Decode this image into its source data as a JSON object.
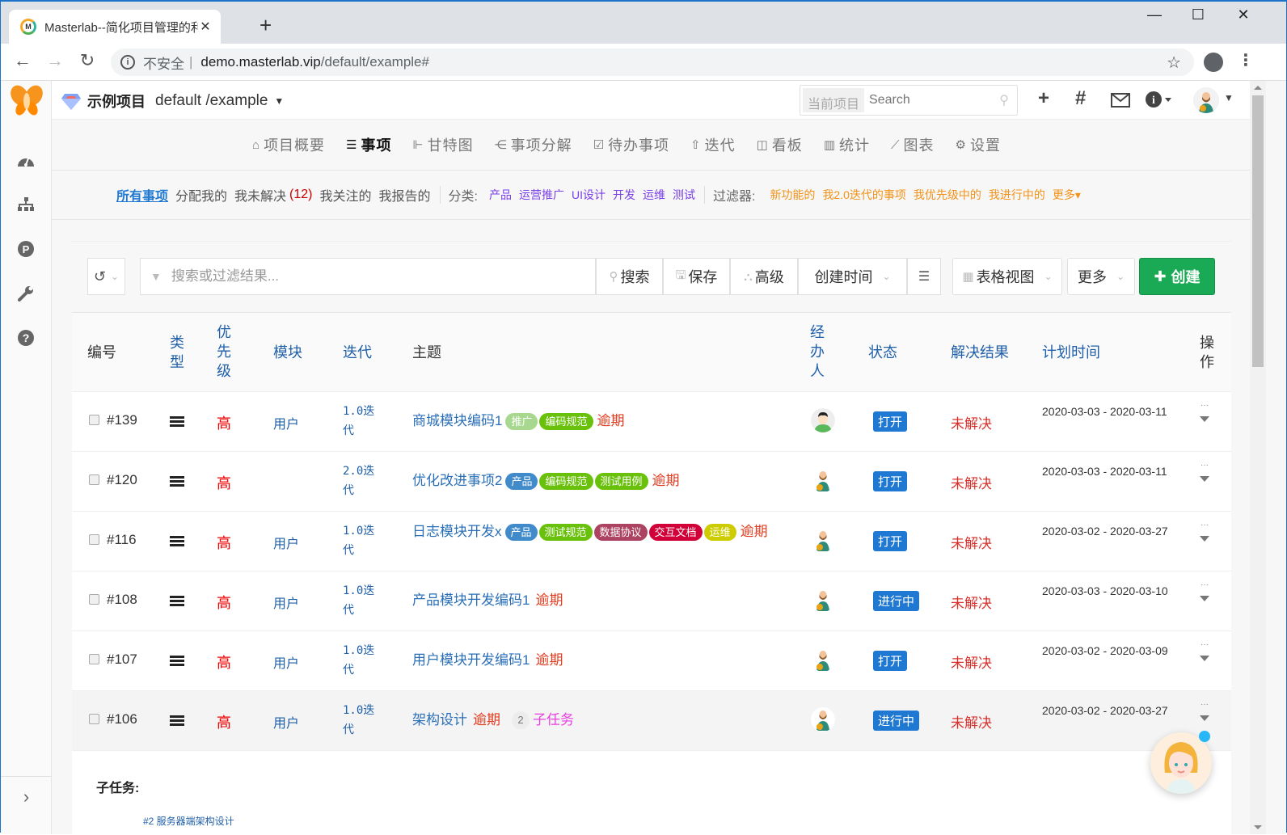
{
  "browser": {
    "tab_title": "Masterlab--简化项目管理的利器",
    "tab_favicon": "masterlab-logo-icon",
    "new_tab": "+",
    "url_insecure": "不安全",
    "url_sep": "|",
    "url_host": "demo.masterlab.vip",
    "url_path": "/default/example#",
    "controls": {
      "minimize": "—",
      "maximize": "☐",
      "close": "✕"
    }
  },
  "header": {
    "project_name": "示例项目",
    "project_path": "default /example",
    "search_scope": "当前项目",
    "search_placeholder": "Search",
    "icons": [
      "plus-icon",
      "hash-icon",
      "mail-icon",
      "info-icon",
      "user-avatar"
    ]
  },
  "sidebar": {
    "icons": [
      "dashboard-icon",
      "sitemap-icon",
      "project-p-icon",
      "wrench-icon",
      "help-icon"
    ],
    "expand": "›"
  },
  "subnav": [
    {
      "icon": "⌂",
      "label": "项目概要",
      "active": false
    },
    {
      "icon": "☰",
      "label": "事项",
      "active": true
    },
    {
      "icon": "⊩",
      "label": "甘特图",
      "active": false
    },
    {
      "icon": "⋲",
      "label": "事项分解",
      "active": false
    },
    {
      "icon": "☑",
      "label": "待办事项",
      "active": false
    },
    {
      "icon": "⇧",
      "label": "迭代",
      "active": false
    },
    {
      "icon": "◫",
      "label": "看板",
      "active": false
    },
    {
      "icon": "▥",
      "label": "统计",
      "active": false
    },
    {
      "icon": "⟋",
      "label": "图表",
      "active": false
    },
    {
      "icon": "⚙",
      "label": "设置",
      "active": false
    }
  ],
  "filters": {
    "all": "所有事项",
    "assigned": "分配我的",
    "unresolved": "我未解决",
    "unresolved_count": "(12)",
    "followed": "我关注的",
    "reported": "我报告的",
    "category_label": "分类:",
    "categories": [
      "产品",
      "运营推广",
      "UI设计",
      "开发",
      "运维",
      "测试"
    ],
    "filter_label": "过滤器:",
    "saved_filters": [
      "新功能的",
      "我2.0迭代的事项",
      "我优先级中的",
      "我进行中的",
      "更多▾"
    ]
  },
  "toolbar": {
    "history_icon": "↺",
    "filter_placeholder": "搜索或过滤结果...",
    "search": "搜索",
    "save": "保存",
    "advanced": "高级",
    "sort_field": "创建时间",
    "view": "表格视图",
    "more": "更多",
    "create": "创建"
  },
  "table": {
    "headers": {
      "id": "编号",
      "type": "类\n型",
      "priority": "优\n先\n级",
      "module": "模块",
      "iteration": "迭代",
      "subject": "主题",
      "assignee": "经\n办\n人",
      "status": "状态",
      "resolution": "解决结果",
      "plan": "计划时间",
      "ops": "操\n作"
    },
    "rows": [
      {
        "id": "#139",
        "priority": "高",
        "module": "用户",
        "iteration": "1.0迭代",
        "subject": "商城模块编码1",
        "tags": [
          {
            "text": "推广",
            "color": "#a8d88f"
          },
          {
            "text": "编码规范",
            "color": "#69c10b"
          }
        ],
        "overdue": "逾期",
        "avatar": "male-avatar-1",
        "status": "打开",
        "resolution": "未解决",
        "plan": "2020-03-03 - 2020-03-11"
      },
      {
        "id": "#120",
        "priority": "高",
        "module": "",
        "iteration": "2.0迭代",
        "subject": "优化改进事项2",
        "tags": [
          {
            "text": "产品",
            "color": "#428bca"
          },
          {
            "text": "编码规范",
            "color": "#69c10b"
          },
          {
            "text": "测试用例",
            "color": "#69c10b"
          }
        ],
        "overdue": "逾期",
        "avatar": "male-avatar-2",
        "status": "打开",
        "resolution": "未解决",
        "plan": "2020-03-03 - 2020-03-11"
      },
      {
        "id": "#116",
        "priority": "高",
        "module": "用户",
        "iteration": "1.0迭代",
        "subject": "日志模块开发x",
        "tags": [
          {
            "text": "产品",
            "color": "#428bca"
          },
          {
            "text": "测试规范",
            "color": "#69c10b"
          },
          {
            "text": "数据协议",
            "color": "#ad4363"
          },
          {
            "text": "交互文档",
            "color": "#d10039"
          },
          {
            "text": "运维",
            "color": "#cccc00"
          }
        ],
        "overdue": "逾期",
        "avatar": "male-avatar-2",
        "status": "打开",
        "resolution": "未解决",
        "plan": "2020-03-02 - 2020-03-27"
      },
      {
        "id": "#108",
        "priority": "高",
        "module": "用户",
        "iteration": "1.0迭代",
        "subject": "产品模块开发编码1",
        "tags": [],
        "overdue": "逾期",
        "avatar": "male-avatar-2",
        "status": "进行中",
        "resolution": "未解决",
        "plan": "2020-03-03 - 2020-03-10"
      },
      {
        "id": "#107",
        "priority": "高",
        "module": "用户",
        "iteration": "1.0迭代",
        "subject": "用户模块开发编码1",
        "tags": [],
        "overdue": "逾期",
        "avatar": "male-avatar-2",
        "status": "打开",
        "resolution": "未解决",
        "plan": "2020-03-02 - 2020-03-09"
      },
      {
        "id": "#106",
        "priority": "高",
        "module": "用户",
        "iteration": "1.0迭代",
        "subject": "架构设计",
        "tags": [],
        "overdue": "逾期",
        "subtask_count": "2",
        "subtask_label": "子任务",
        "avatar": "male-avatar-2",
        "status": "进行中",
        "resolution": "未解决",
        "plan": "2020-03-02 - 2020-03-27"
      }
    ]
  },
  "subtasks": {
    "title": "子任务:",
    "first_item": "#2 服务器端架构设计"
  }
}
